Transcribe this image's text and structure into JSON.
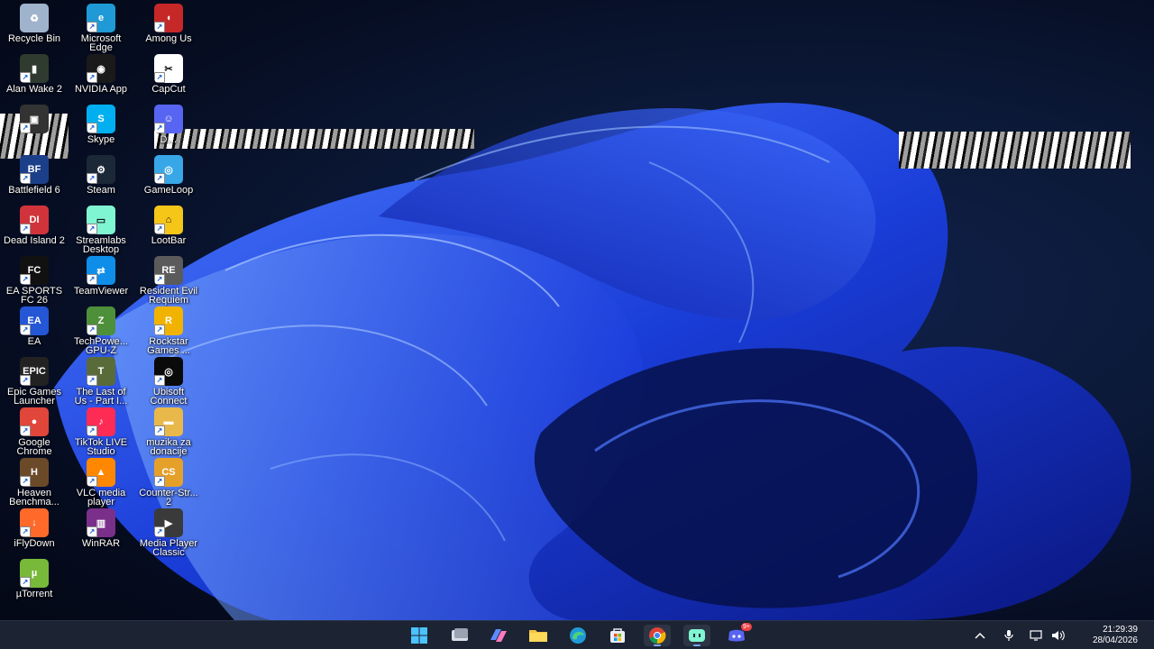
{
  "desktop": {
    "icons": [
      {
        "label": "Recycle Bin",
        "icon": "recycle-bin-icon",
        "color": "#9fb4cc"
      },
      {
        "label": "Microsoft\nEdge",
        "icon": "edge-icon",
        "color": "#1f9ad6"
      },
      {
        "label": "Among Us",
        "icon": "among-us-icon",
        "color": "#c62828"
      },
      {
        "label": "Alan Wake 2",
        "icon": "alan-wake-icon",
        "color": "#2e3b2e"
      },
      {
        "label": "NVIDIA App",
        "icon": "nvidia-icon",
        "color": "#1a1a1a"
      },
      {
        "label": "CapCut",
        "icon": "capcut-icon",
        "color": "#ffffff"
      },
      {
        "label": "",
        "icon": "game-shortcut-icon",
        "color": "#333333"
      },
      {
        "label": "Skype",
        "icon": "skype-icon",
        "color": "#00aff0"
      },
      {
        "label": "D…",
        "icon": "discord-icon",
        "color": "#5865f2"
      },
      {
        "label": "Battlefield 6",
        "icon": "battlefield-icon",
        "color": "#1c3f8a"
      },
      {
        "label": "Steam",
        "icon": "steam-icon",
        "color": "#1b2838"
      },
      {
        "label": "GameLoop",
        "icon": "gameloop-icon",
        "color": "#37a7e8"
      },
      {
        "label": "Dead Island 2",
        "icon": "dead-island-icon",
        "color": "#d0343a"
      },
      {
        "label": "Streamlabs\nDesktop",
        "icon": "streamlabs-icon",
        "color": "#80f5d2"
      },
      {
        "label": "LootBar",
        "icon": "lootbar-icon",
        "color": "#f5c518"
      },
      {
        "label": "EA SPORTS\nFC 26",
        "icon": "ea-fc-icon",
        "color": "#111111"
      },
      {
        "label": "TeamViewer",
        "icon": "teamviewer-icon",
        "color": "#0e8ee9"
      },
      {
        "label": "Resident Evil\nRequiem",
        "icon": "resident-evil-icon",
        "color": "#5b5b5b"
      },
      {
        "label": "EA",
        "icon": "ea-icon",
        "color": "#2456d6"
      },
      {
        "label": "TechPowe...\nGPU-Z",
        "icon": "gpuz-icon",
        "color": "#4e8f3a"
      },
      {
        "label": "Rockstar\nGames ...",
        "icon": "rockstar-icon",
        "color": "#f2b300"
      },
      {
        "label": "Epic Games\nLauncher",
        "icon": "epic-games-icon",
        "color": "#222222"
      },
      {
        "label": "The Last of\nUs - Part I...",
        "icon": "last-of-us-icon",
        "color": "#5a6b3a"
      },
      {
        "label": "Ubisoft\nConnect",
        "icon": "ubisoft-icon",
        "color": "#0a0a0a"
      },
      {
        "label": "Google\nChrome",
        "icon": "chrome-icon",
        "color": "#e0463a"
      },
      {
        "label": "TikTok LIVE\nStudio",
        "icon": "tiktok-live-icon",
        "color": "#fe2c55"
      },
      {
        "label": "muzika za\ndonacije",
        "icon": "folder-icon",
        "color": "#e8b84a"
      },
      {
        "label": "Heaven\nBenchma...",
        "icon": "heaven-benchmark-icon",
        "color": "#6b4a2a"
      },
      {
        "label": "VLC media\nplayer",
        "icon": "vlc-icon",
        "color": "#ff8800"
      },
      {
        "label": "Counter-Str...\n2",
        "icon": "counter-strike-icon",
        "color": "#e5a02a"
      },
      {
        "label": "iFlyDown",
        "icon": "iflydown-icon",
        "color": "#ff6a2a"
      },
      {
        "label": "WinRAR",
        "icon": "winrar-icon",
        "color": "#7a2f8a"
      },
      {
        "label": "Media Player\nClassic",
        "icon": "media-player-classic-icon",
        "color": "#3a3a3a"
      },
      {
        "label": "µTorrent",
        "icon": "utorrent-icon",
        "color": "#79b93a"
      }
    ]
  },
  "taskbar": {
    "apps": [
      {
        "icon": "windows-start-icon"
      },
      {
        "icon": "task-view-icon"
      },
      {
        "icon": "copilot-icon"
      },
      {
        "icon": "file-explorer-icon"
      },
      {
        "icon": "edge-icon"
      },
      {
        "icon": "microsoft-store-icon"
      },
      {
        "icon": "chrome-icon"
      },
      {
        "icon": "streamlabs-icon"
      },
      {
        "icon": "discord-icon"
      }
    ],
    "discord_badge": "9+",
    "tray": {
      "time": "21:29:39",
      "date": "28/04/2026"
    }
  }
}
